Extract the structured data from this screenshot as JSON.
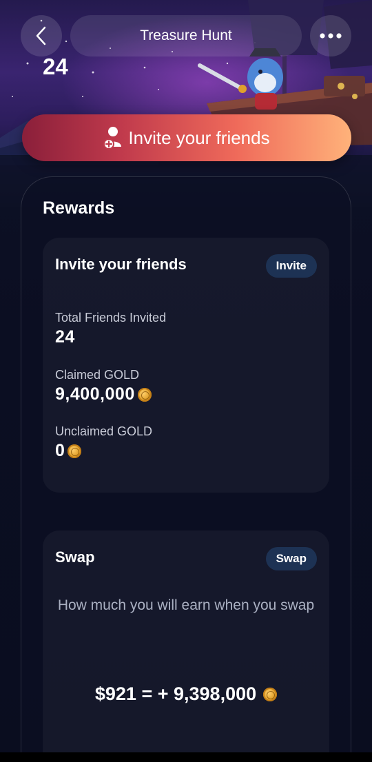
{
  "header": {
    "title": "Treasure Hunt",
    "back_icon": "chevron-left-icon",
    "more_icon": "more-dots-icon"
  },
  "hero": {
    "count": "24"
  },
  "invite_cta": {
    "label": "Invite your friends",
    "icon": "add-user-icon"
  },
  "rewards": {
    "title": "Rewards",
    "invite_card": {
      "title": "Invite your friends",
      "button_label": "Invite",
      "stats": [
        {
          "label": "Total Friends Invited",
          "value": "24",
          "coin": false
        },
        {
          "label": "Claimed GOLD",
          "value": "9,400,000",
          "coin": true
        },
        {
          "label": "Unclaimed GOLD",
          "value": "0",
          "coin": true
        }
      ]
    },
    "swap_card": {
      "title": "Swap",
      "button_label": "Swap",
      "description": "How much you will earn when you swap",
      "usd_value": "$921",
      "equals": " = + ",
      "gold_value": "9,398,000"
    }
  },
  "colors": {
    "accent_start": "#8a1f3a",
    "accent_end": "#ffb27a",
    "pill_button": "#1d3254",
    "background": "#0b0d1d",
    "coin": "#e0a02b"
  }
}
